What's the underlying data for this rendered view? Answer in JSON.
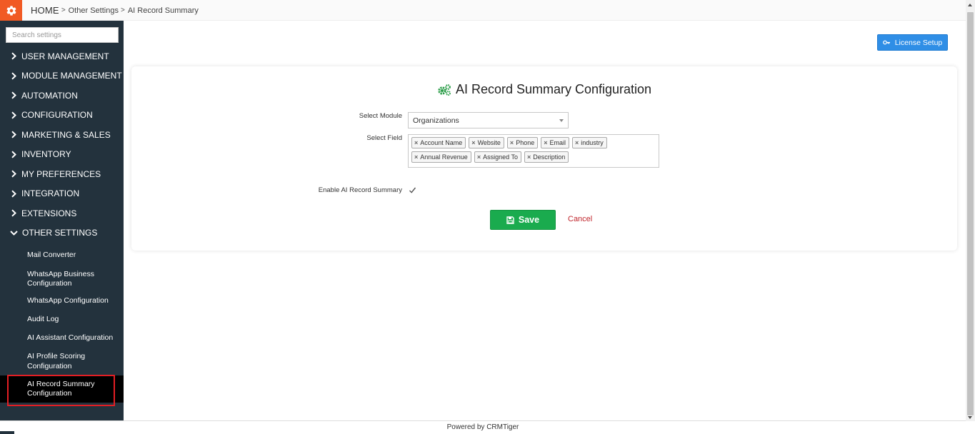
{
  "breadcrumb": {
    "home": "HOME",
    "sep1": ">",
    "item1": "Other Settings",
    "sep2": ">",
    "item2": "AI Record Summary"
  },
  "sidebar": {
    "search_placeholder": "Search settings",
    "menu": [
      {
        "label": "USER MANAGEMENT"
      },
      {
        "label": "MODULE MANAGEMENT"
      },
      {
        "label": "AUTOMATION"
      },
      {
        "label": "CONFIGURATION"
      },
      {
        "label": "MARKETING & SALES"
      },
      {
        "label": "INVENTORY"
      },
      {
        "label": "MY PREFERENCES"
      },
      {
        "label": "INTEGRATION"
      },
      {
        "label": "EXTENSIONS"
      },
      {
        "label": "OTHER SETTINGS"
      }
    ],
    "submenu": [
      {
        "label": "Mail Converter"
      },
      {
        "label": "WhatsApp Business Configuration"
      },
      {
        "label": "WhatsApp Configuration"
      },
      {
        "label": "Audit Log"
      },
      {
        "label": "AI Assistant Configuration"
      },
      {
        "label": "AI Profile Scoring Configuration"
      },
      {
        "label": "AI Record Summary Configuration"
      }
    ]
  },
  "header": {
    "license_button": "License Setup"
  },
  "form": {
    "title": "AI Record Summary Configuration",
    "module_label": "Select Module",
    "module_value": "Organizations",
    "field_label": "Select Field",
    "fields": [
      {
        "label": "Account Name"
      },
      {
        "label": "Website"
      },
      {
        "label": "Phone"
      },
      {
        "label": "Email"
      },
      {
        "label": "industry"
      },
      {
        "label": "Annual Revenue"
      },
      {
        "label": "Assigned To"
      },
      {
        "label": "Description"
      }
    ],
    "enable_label": "Enable AI Record Summary",
    "enabled": true,
    "save_label": "Save",
    "cancel_label": "Cancel"
  },
  "footer": {
    "text": "Powered by CRMTiger"
  },
  "colors": {
    "accent_orange": "#f15a24",
    "sidebar_bg": "#23323d",
    "primary_blue": "#2f8ee6",
    "save_green": "#1aab4e",
    "cancel_red": "#c0262d",
    "highlight_red": "#e31e24"
  },
  "icons": {
    "top_gear": "gear-icon",
    "title_gears": "gears-icon",
    "license_key": "key-icon",
    "save": "floppy-icon",
    "menu_chevron": "chevron-right-icon",
    "menu_chevron_open": "chevron-down-icon",
    "tag_remove": "remove-x-icon",
    "checkbox": "checkmark-icon"
  }
}
